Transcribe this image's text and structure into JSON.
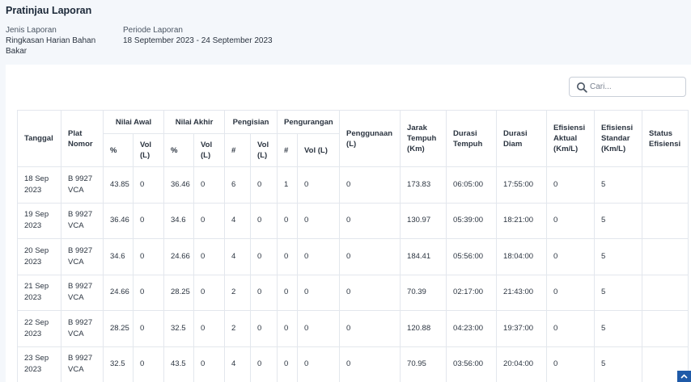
{
  "page": {
    "title": "Pratinjau Laporan"
  },
  "report_meta": {
    "type_label": "Jenis Laporan",
    "type_value": "Ringkasan Harian Bahan Bakar",
    "period_label": "Periode Laporan",
    "period_value": "18 September 2023 - 24 September 2023"
  },
  "search": {
    "placeholder": "Cari...",
    "value": ""
  },
  "table": {
    "headers": {
      "tanggal": "Tanggal",
      "plat": "Plat Nomor",
      "nilai_awal": "Nilai Awal",
      "nilai_akhir": "Nilai Akhir",
      "pengisian": "Pengisian",
      "pengurangan": "Pengurangan",
      "penggunaan": "Penggunaan (L)",
      "jarak": "Jarak Tempuh (Km)",
      "durasi_tempuh": "Durasi Tempuh",
      "durasi_diam": "Durasi Diam",
      "efisiensi_aktual": "Efisiensi Aktual (Km/L)",
      "efisiensi_standar": "Efisiensi Standar (Km/L)",
      "status": "Status Efisiensi",
      "pct": "%",
      "vol": "Vol (L)",
      "num": "#"
    },
    "rows": [
      {
        "tanggal": "18 Sep 2023",
        "plat": "B 9927 VCA",
        "awal_pct": "43.85",
        "awal_vol": "0",
        "akhir_pct": "36.46",
        "akhir_vol": "0",
        "isi_num": "6",
        "isi_vol": "0",
        "kurang_num": "1",
        "kurang_vol": "0",
        "penggunaan": "0",
        "jarak": "173.83",
        "durasi_tempuh": "06:05:00",
        "durasi_diam": "17:55:00",
        "ef_aktual": "0",
        "ef_standar": "5",
        "status": ""
      },
      {
        "tanggal": "19 Sep 2023",
        "plat": "B 9927 VCA",
        "awal_pct": "36.46",
        "awal_vol": "0",
        "akhir_pct": "34.6",
        "akhir_vol": "0",
        "isi_num": "4",
        "isi_vol": "0",
        "kurang_num": "0",
        "kurang_vol": "0",
        "penggunaan": "0",
        "jarak": "130.97",
        "durasi_tempuh": "05:39:00",
        "durasi_diam": "18:21:00",
        "ef_aktual": "0",
        "ef_standar": "5",
        "status": ""
      },
      {
        "tanggal": "20 Sep 2023",
        "plat": "B 9927 VCA",
        "awal_pct": "34.6",
        "awal_vol": "0",
        "akhir_pct": "24.66",
        "akhir_vol": "0",
        "isi_num": "4",
        "isi_vol": "0",
        "kurang_num": "0",
        "kurang_vol": "0",
        "penggunaan": "0",
        "jarak": "184.41",
        "durasi_tempuh": "05:56:00",
        "durasi_diam": "18:04:00",
        "ef_aktual": "0",
        "ef_standar": "5",
        "status": ""
      },
      {
        "tanggal": "21 Sep 2023",
        "plat": "B 9927 VCA",
        "awal_pct": "24.66",
        "awal_vol": "0",
        "akhir_pct": "28.25",
        "akhir_vol": "0",
        "isi_num": "2",
        "isi_vol": "0",
        "kurang_num": "0",
        "kurang_vol": "0",
        "penggunaan": "0",
        "jarak": "70.39",
        "durasi_tempuh": "02:17:00",
        "durasi_diam": "21:43:00",
        "ef_aktual": "0",
        "ef_standar": "5",
        "status": ""
      },
      {
        "tanggal": "22 Sep 2023",
        "plat": "B 9927 VCA",
        "awal_pct": "28.25",
        "awal_vol": "0",
        "akhir_pct": "32.5",
        "akhir_vol": "0",
        "isi_num": "2",
        "isi_vol": "0",
        "kurang_num": "0",
        "kurang_vol": "0",
        "penggunaan": "0",
        "jarak": "120.88",
        "durasi_tempuh": "04:23:00",
        "durasi_diam": "19:37:00",
        "ef_aktual": "0",
        "ef_standar": "5",
        "status": ""
      },
      {
        "tanggal": "23 Sep 2023",
        "plat": "B 9927 VCA",
        "awal_pct": "32.5",
        "awal_vol": "0",
        "akhir_pct": "43.5",
        "akhir_vol": "0",
        "isi_num": "4",
        "isi_vol": "0",
        "kurang_num": "0",
        "kurang_vol": "0",
        "penggunaan": "0",
        "jarak": "70.95",
        "durasi_tempuh": "03:56:00",
        "durasi_diam": "20:04:00",
        "ef_aktual": "0",
        "ef_standar": "5",
        "status": ""
      }
    ]
  },
  "icons": {
    "search": "search-icon",
    "scroll_top": "chevron-up-icon"
  },
  "colors": {
    "accent": "#1f5aa8",
    "border": "#e3e7ed",
    "background": "#f4f7fb"
  }
}
